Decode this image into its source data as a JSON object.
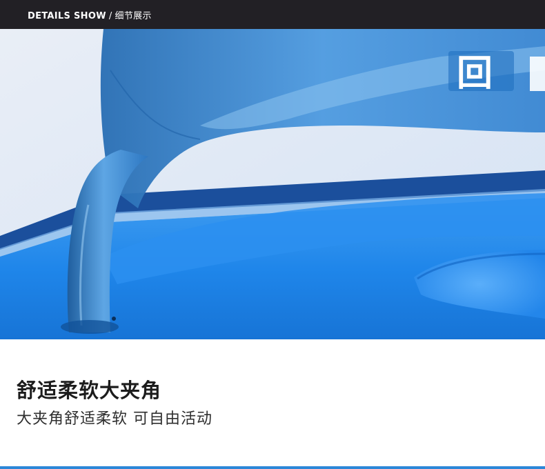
{
  "header": {
    "title_en": "DETAILS SHOW",
    "separator": "/",
    "title_cn": "细节展示"
  },
  "product_image": {
    "subject": "blue-flip-flop-toe-post-closeup",
    "logo_glyph": "回",
    "colors": {
      "sole": "#1a82e8",
      "strap": "#3a8ed6",
      "background": "#dfe9f6",
      "header_bar": "#222025"
    }
  },
  "feature": {
    "title": "舒适柔软大夹角",
    "subtitle": "大夹角舒适柔软 可自由活动"
  }
}
